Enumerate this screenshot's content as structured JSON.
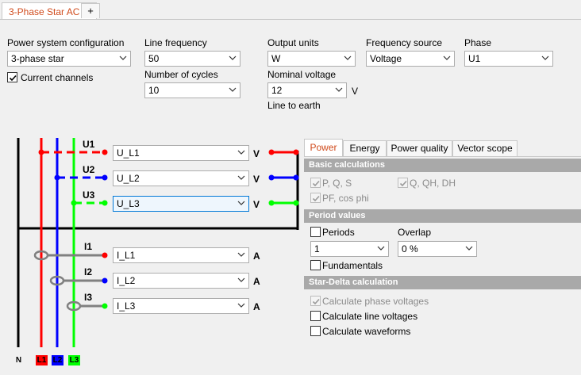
{
  "tabs": {
    "main_label": "3-Phase Star AC",
    "add_label": "+"
  },
  "config": {
    "power_system_label": "Power system configuration",
    "power_system_value": "3-phase star",
    "current_channels_label": "Current channels",
    "current_channels_checked": true,
    "line_frequency_label": "Line frequency",
    "line_frequency_value": "50",
    "cycles_label": "Number of cycles",
    "cycles_value": "10",
    "output_units_label": "Output units",
    "output_units_value": "W",
    "nominal_voltage_label": "Nominal voltage",
    "nominal_voltage_value": "12",
    "nominal_voltage_unit": "V",
    "line_to_earth": "Line to earth",
    "frequency_source_label": "Frequency source",
    "frequency_source_value": "Voltage",
    "phase_label": "Phase",
    "phase_value": "U1"
  },
  "diagram": {
    "voltages": [
      {
        "label": "U1",
        "channel": "U_L1",
        "unit": "V",
        "color": "#ff0000"
      },
      {
        "label": "U2",
        "channel": "U_L2",
        "unit": "V",
        "color": "#0000ff"
      },
      {
        "label": "U3",
        "channel": "U_L3",
        "unit": "V",
        "color": "#00ff00"
      }
    ],
    "currents": [
      {
        "label": "I1",
        "channel": "I_L1",
        "unit": "A",
        "color": "#ff0000"
      },
      {
        "label": "I2",
        "channel": "I_L2",
        "unit": "A",
        "color": "#0000ff"
      },
      {
        "label": "I3",
        "channel": "I_L3",
        "unit": "A",
        "color": "#00ff00"
      }
    ],
    "phase_tags": {
      "n": "N",
      "l1": "L1",
      "l2": "L2",
      "l3": "L3"
    }
  },
  "right_panel": {
    "tabs": [
      "Power",
      "Energy",
      "Power quality",
      "Vector scope"
    ],
    "active_tab": "Power",
    "basic_calculations": {
      "title": "Basic calculations",
      "pqs": "P, Q, S",
      "qqhdh": "Q, QH, DH",
      "pf": "PF, cos phi"
    },
    "period_values": {
      "title": "Period values",
      "periods_label": "Periods",
      "periods_value": "1",
      "overlap_label": "Overlap",
      "overlap_value": "0 %",
      "fundamentals_label": "Fundamentals"
    },
    "star_delta": {
      "title": "Star-Delta calculation",
      "phase_voltages": "Calculate phase voltages",
      "line_voltages": "Calculate line voltages",
      "waveforms": "Calculate waveforms"
    }
  }
}
